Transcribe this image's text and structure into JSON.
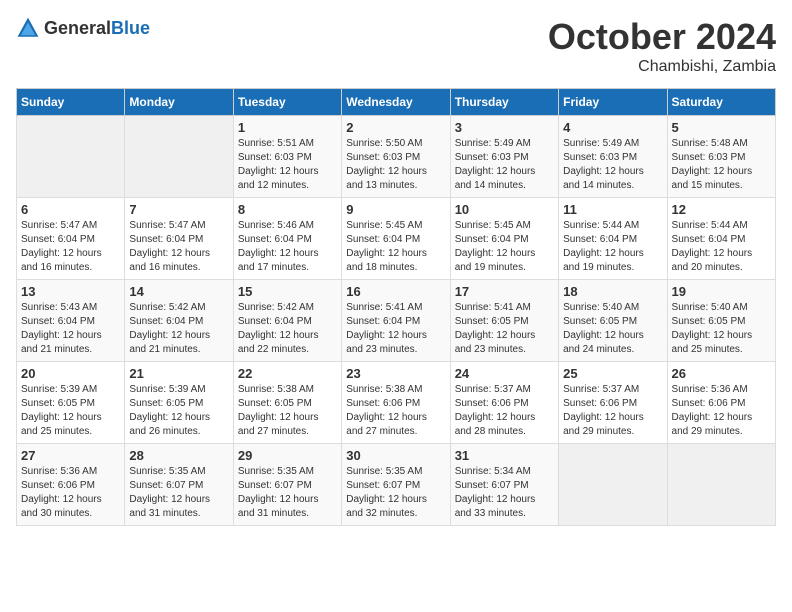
{
  "header": {
    "logo_general": "General",
    "logo_blue": "Blue",
    "month": "October 2024",
    "location": "Chambishi, Zambia"
  },
  "weekdays": [
    "Sunday",
    "Monday",
    "Tuesday",
    "Wednesday",
    "Thursday",
    "Friday",
    "Saturday"
  ],
  "weeks": [
    [
      {
        "day": "",
        "info": ""
      },
      {
        "day": "",
        "info": ""
      },
      {
        "day": "1",
        "info": "Sunrise: 5:51 AM\nSunset: 6:03 PM\nDaylight: 12 hours and 12 minutes."
      },
      {
        "day": "2",
        "info": "Sunrise: 5:50 AM\nSunset: 6:03 PM\nDaylight: 12 hours and 13 minutes."
      },
      {
        "day": "3",
        "info": "Sunrise: 5:49 AM\nSunset: 6:03 PM\nDaylight: 12 hours and 14 minutes."
      },
      {
        "day": "4",
        "info": "Sunrise: 5:49 AM\nSunset: 6:03 PM\nDaylight: 12 hours and 14 minutes."
      },
      {
        "day": "5",
        "info": "Sunrise: 5:48 AM\nSunset: 6:03 PM\nDaylight: 12 hours and 15 minutes."
      }
    ],
    [
      {
        "day": "6",
        "info": "Sunrise: 5:47 AM\nSunset: 6:04 PM\nDaylight: 12 hours and 16 minutes."
      },
      {
        "day": "7",
        "info": "Sunrise: 5:47 AM\nSunset: 6:04 PM\nDaylight: 12 hours and 16 minutes."
      },
      {
        "day": "8",
        "info": "Sunrise: 5:46 AM\nSunset: 6:04 PM\nDaylight: 12 hours and 17 minutes."
      },
      {
        "day": "9",
        "info": "Sunrise: 5:45 AM\nSunset: 6:04 PM\nDaylight: 12 hours and 18 minutes."
      },
      {
        "day": "10",
        "info": "Sunrise: 5:45 AM\nSunset: 6:04 PM\nDaylight: 12 hours and 19 minutes."
      },
      {
        "day": "11",
        "info": "Sunrise: 5:44 AM\nSunset: 6:04 PM\nDaylight: 12 hours and 19 minutes."
      },
      {
        "day": "12",
        "info": "Sunrise: 5:44 AM\nSunset: 6:04 PM\nDaylight: 12 hours and 20 minutes."
      }
    ],
    [
      {
        "day": "13",
        "info": "Sunrise: 5:43 AM\nSunset: 6:04 PM\nDaylight: 12 hours and 21 minutes."
      },
      {
        "day": "14",
        "info": "Sunrise: 5:42 AM\nSunset: 6:04 PM\nDaylight: 12 hours and 21 minutes."
      },
      {
        "day": "15",
        "info": "Sunrise: 5:42 AM\nSunset: 6:04 PM\nDaylight: 12 hours and 22 minutes."
      },
      {
        "day": "16",
        "info": "Sunrise: 5:41 AM\nSunset: 6:04 PM\nDaylight: 12 hours and 23 minutes."
      },
      {
        "day": "17",
        "info": "Sunrise: 5:41 AM\nSunset: 6:05 PM\nDaylight: 12 hours and 23 minutes."
      },
      {
        "day": "18",
        "info": "Sunrise: 5:40 AM\nSunset: 6:05 PM\nDaylight: 12 hours and 24 minutes."
      },
      {
        "day": "19",
        "info": "Sunrise: 5:40 AM\nSunset: 6:05 PM\nDaylight: 12 hours and 25 minutes."
      }
    ],
    [
      {
        "day": "20",
        "info": "Sunrise: 5:39 AM\nSunset: 6:05 PM\nDaylight: 12 hours and 25 minutes."
      },
      {
        "day": "21",
        "info": "Sunrise: 5:39 AM\nSunset: 6:05 PM\nDaylight: 12 hours and 26 minutes."
      },
      {
        "day": "22",
        "info": "Sunrise: 5:38 AM\nSunset: 6:05 PM\nDaylight: 12 hours and 27 minutes."
      },
      {
        "day": "23",
        "info": "Sunrise: 5:38 AM\nSunset: 6:06 PM\nDaylight: 12 hours and 27 minutes."
      },
      {
        "day": "24",
        "info": "Sunrise: 5:37 AM\nSunset: 6:06 PM\nDaylight: 12 hours and 28 minutes."
      },
      {
        "day": "25",
        "info": "Sunrise: 5:37 AM\nSunset: 6:06 PM\nDaylight: 12 hours and 29 minutes."
      },
      {
        "day": "26",
        "info": "Sunrise: 5:36 AM\nSunset: 6:06 PM\nDaylight: 12 hours and 29 minutes."
      }
    ],
    [
      {
        "day": "27",
        "info": "Sunrise: 5:36 AM\nSunset: 6:06 PM\nDaylight: 12 hours and 30 minutes."
      },
      {
        "day": "28",
        "info": "Sunrise: 5:35 AM\nSunset: 6:07 PM\nDaylight: 12 hours and 31 minutes."
      },
      {
        "day": "29",
        "info": "Sunrise: 5:35 AM\nSunset: 6:07 PM\nDaylight: 12 hours and 31 minutes."
      },
      {
        "day": "30",
        "info": "Sunrise: 5:35 AM\nSunset: 6:07 PM\nDaylight: 12 hours and 32 minutes."
      },
      {
        "day": "31",
        "info": "Sunrise: 5:34 AM\nSunset: 6:07 PM\nDaylight: 12 hours and 33 minutes."
      },
      {
        "day": "",
        "info": ""
      },
      {
        "day": "",
        "info": ""
      }
    ]
  ]
}
